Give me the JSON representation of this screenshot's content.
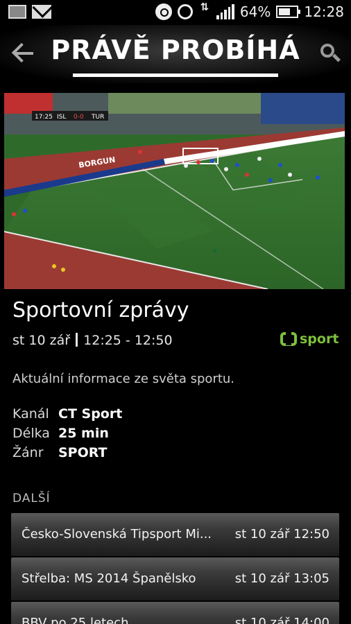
{
  "status_bar": {
    "battery": "64%",
    "battery_level": 0.64,
    "time": "12:28",
    "icons": [
      "image-icon",
      "mail-icon",
      "beats-icon",
      "alarm-icon",
      "data-arrows-icon",
      "signal-icon",
      "battery-icon"
    ]
  },
  "header": {
    "title": "PRÁVĚ PROBÍHÁ",
    "back_icon": "arrow-left-icon",
    "search_icon": "search-icon"
  },
  "video": {
    "scoreboard": {
      "time": "17:25",
      "home": "ISL",
      "score": "0-0",
      "away": "TUR"
    },
    "ad_text": "BORGUN"
  },
  "program": {
    "title": "Sportovní zprávy",
    "date": "st 10 zář",
    "time_range": "12:25 - 12:50",
    "channel_logo": "sport",
    "description": "Aktuální informace ze světa sportu.",
    "details": [
      {
        "key": "Kanál",
        "value": "CT Sport"
      },
      {
        "key": "Délka",
        "value": "25 min"
      },
      {
        "key": "Žánr",
        "value": "SPORT"
      }
    ]
  },
  "next": {
    "label": "DALŠÍ",
    "items": [
      {
        "name": "Česko-Slovenská Tipsport Mi...",
        "when": "st 10 zář 12:50"
      },
      {
        "name": "Střelba: MS 2014 Španělsko",
        "when": "st 10 zář 13:05"
      },
      {
        "name": "BBV po 25 letech",
        "when": "st 10 zář 14:00"
      }
    ]
  },
  "colors": {
    "accent_green": "#7ec03b",
    "background": "#000000",
    "pitch": "#2e6b2a"
  }
}
